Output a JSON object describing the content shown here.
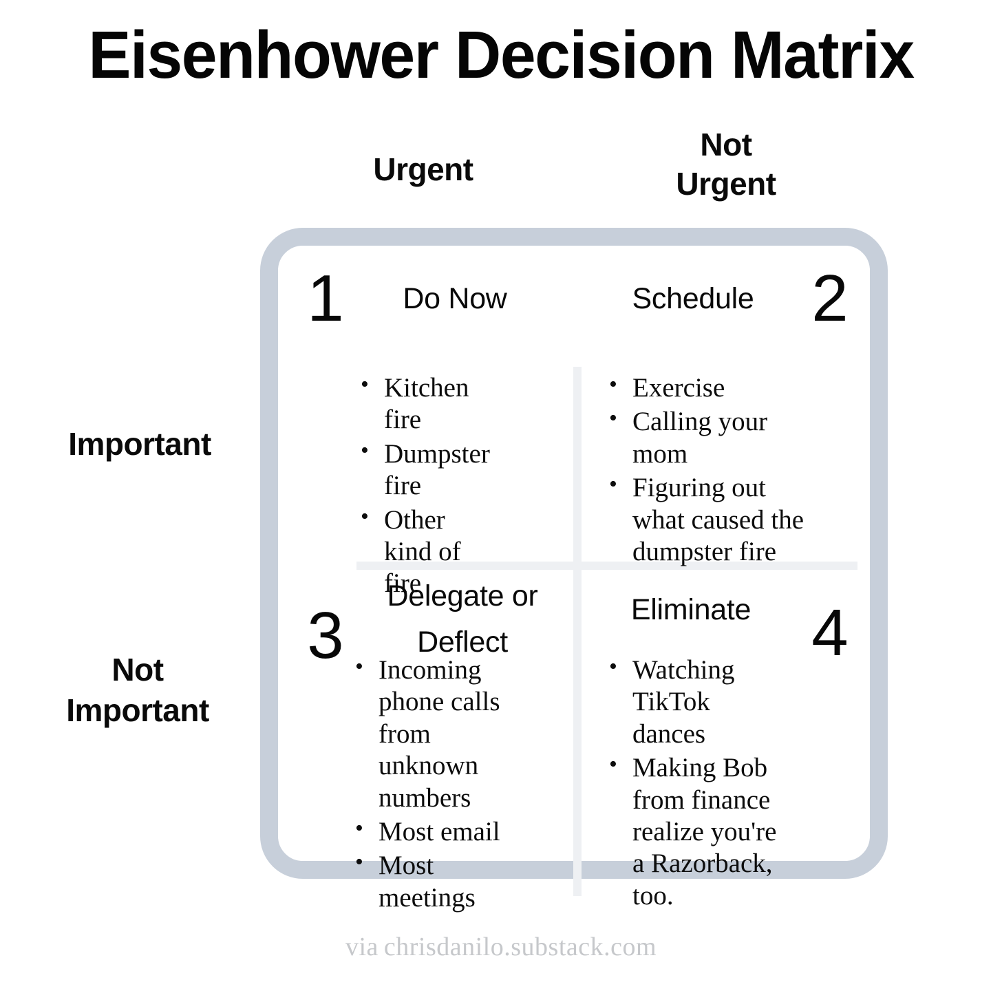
{
  "title": "Eisenhower Decision Matrix",
  "axes": {
    "columns": [
      {
        "label": "Urgent"
      },
      {
        "label": "Not\nUrgent"
      }
    ],
    "rows": [
      {
        "label": "Important"
      },
      {
        "label": "Not\nImportant"
      }
    ]
  },
  "colors": {
    "frame_border": "#c7cfda",
    "divider": "#eef0f3",
    "text": "#0a0a0a",
    "footer_text": "#c6c8cb",
    "background": "#ffffff"
  },
  "quadrants": [
    {
      "number": "1",
      "title": "Do Now",
      "number_side": "left",
      "axis": "Urgent / Important",
      "items": [
        "Kitchen fire",
        "Dumpster fire",
        "Other kind of fire"
      ]
    },
    {
      "number": "2",
      "title": "Schedule",
      "number_side": "right",
      "axis": "Not Urgent / Important",
      "items": [
        "Exercise",
        "Calling your mom",
        "Figuring out what caused the dumpster fire"
      ]
    },
    {
      "number": "3",
      "title": "Delegate or Deflect",
      "number_side": "left",
      "axis": "Urgent / Not Important",
      "items": [
        "Incoming phone calls from unknown numbers",
        "Most email",
        "Most meetings"
      ]
    },
    {
      "number": "4",
      "title": "Eliminate",
      "number_side": "right",
      "axis": "Not Urgent / Not Important",
      "items": [
        "Watching TikTok dances",
        "Making Bob from finance realize you're a Razorback, too."
      ]
    }
  ],
  "footer": {
    "via": "via",
    "source": "chrisdanilo.substack.com"
  }
}
